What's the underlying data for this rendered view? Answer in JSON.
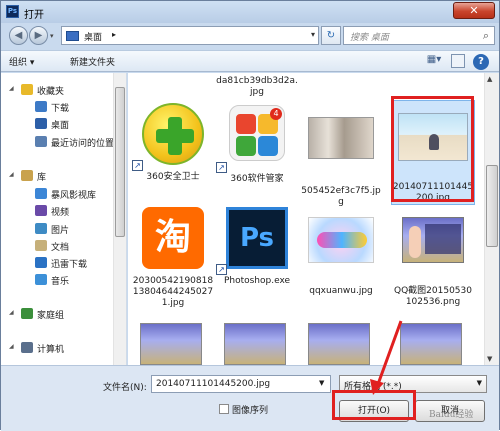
{
  "window": {
    "title": "打开",
    "close_glyph": "✕",
    "app_badge": "Ps"
  },
  "address": {
    "location": "桌面",
    "separator": "▸",
    "search_placeholder": "搜索 桌面"
  },
  "toolbar": {
    "organize": "组织 ▾",
    "new_folder": "新建文件夹"
  },
  "nav": {
    "items": [
      {
        "label": "收藏夹",
        "icon": "star-icon",
        "color": "#e8b92a"
      },
      {
        "label": "下载",
        "icon": "download-folder-icon",
        "color": "#3d7ac6"
      },
      {
        "label": "桌面",
        "icon": "desktop-icon",
        "color": "#2d5fa8"
      },
      {
        "label": "最近访问的位置",
        "icon": "recent-places-icon",
        "color": "#5a7fb0"
      },
      {
        "label": "库",
        "icon": "library-icon",
        "color": "#c9a24d"
      },
      {
        "label": "暴风影视库",
        "icon": "video-library-icon",
        "color": "#3c86d6"
      },
      {
        "label": "视频",
        "icon": "video-icon",
        "color": "#6a4aa8"
      },
      {
        "label": "图片",
        "icon": "pictures-icon",
        "color": "#3e8bc4"
      },
      {
        "label": "文档",
        "icon": "documents-icon",
        "color": "#c6b07a"
      },
      {
        "label": "迅雷下载",
        "icon": "thunder-download-icon",
        "color": "#2a72c4"
      },
      {
        "label": "音乐",
        "icon": "music-icon",
        "color": "#3c90d8"
      },
      {
        "label": "家庭组",
        "icon": "homegroup-icon",
        "color": "#3b8f3b"
      },
      {
        "label": "计算机",
        "icon": "computer-icon",
        "color": "#5a6f8c"
      }
    ]
  },
  "files": [
    {
      "name": "da81cb39db3d2a.jpg",
      "kind": "cut-top"
    },
    {
      "name": "360安全卫士",
      "kind": "360",
      "shortcut": true
    },
    {
      "name": "360软件管家",
      "kind": "360mgr",
      "shortcut": true,
      "badge": "4"
    },
    {
      "name": "505452ef3c7f5.jpg",
      "kind": "photo-girls"
    },
    {
      "name": "20140711101445200.jpg",
      "kind": "photo-beach",
      "selected": true
    },
    {
      "name": "20300542190818138046442450271.jpg",
      "kind": "taobao",
      "glyph": "淘"
    },
    {
      "name": "Photoshop.exe",
      "kind": "ps",
      "glyph": "Ps",
      "shortcut": true
    },
    {
      "name": "qqxuanwu.jpg",
      "kind": "qqxw"
    },
    {
      "name": "QQ截图20150530102536.png",
      "kind": "game"
    }
  ],
  "bottom": {
    "filename_label": "文件名(N):",
    "filename_value": "20140711101445200.jpg",
    "filetype_value": "所有格式 (*.*)",
    "sequence_label": "图像序列",
    "open_label": "打开(O)",
    "cancel_label": "取消"
  },
  "watermark": "Baidu经验",
  "colors": {
    "highlight": "#e02020",
    "window": "#c9daee"
  }
}
